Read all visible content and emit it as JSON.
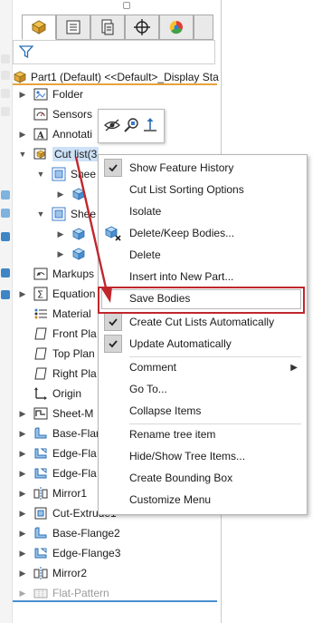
{
  "tabs": [
    {
      "icon": "feature-manager-icon",
      "active": true
    },
    {
      "icon": "property-manager-icon",
      "active": false
    },
    {
      "icon": "configuration-manager-icon",
      "active": false
    },
    {
      "icon": "dimxpert-manager-icon",
      "active": false
    },
    {
      "icon": "display-manager-icon",
      "active": false
    }
  ],
  "filter": {
    "icon": "filter-icon"
  },
  "tree": {
    "root_label": "Part1 (Default) <<Default>_Display Sta",
    "items": [
      {
        "label": "Folder"
      },
      {
        "label": "Sensors"
      },
      {
        "label": "Annotati"
      },
      {
        "label": "Cut list(3"
      },
      {
        "label": "Shee"
      },
      {
        "label": ""
      },
      {
        "label": "Shee"
      },
      {
        "label": ""
      },
      {
        "label": ""
      },
      {
        "label": "Markups"
      },
      {
        "label": "Equation"
      },
      {
        "label": "Material"
      },
      {
        "label": "Front Pla"
      },
      {
        "label": "Top Plan"
      },
      {
        "label": "Right Pla"
      },
      {
        "label": "Origin"
      },
      {
        "label": "Sheet-M"
      },
      {
        "label": "Base-Flan"
      },
      {
        "label": "Edge-Fla"
      },
      {
        "label": "Edge-Fla"
      },
      {
        "label": "Mirror1"
      },
      {
        "label": "Cut-Extrude1"
      },
      {
        "label": "Base-Flange2"
      },
      {
        "label": "Edge-Flange3"
      },
      {
        "label": "Mirror2"
      },
      {
        "label": "Flat-Pattern"
      }
    ]
  },
  "context_toolbar": [
    "hide-show-icon",
    "zoom-to-selection-icon",
    "normal-to-icon"
  ],
  "menu": {
    "items": [
      {
        "label": "Show Feature History",
        "checked": true
      },
      {
        "label": "Cut List Sorting Options"
      },
      {
        "label": "Isolate"
      },
      {
        "label": "Delete/Keep Bodies..."
      },
      {
        "label": "Delete"
      },
      {
        "label": "Insert into New Part..."
      },
      {
        "label": "Save Bodies"
      },
      {
        "label": "Create Cut Lists Automatically",
        "checked": true
      },
      {
        "label": "Update Automatically",
        "checked": true
      },
      {
        "label": "Comment",
        "submenu": true
      },
      {
        "label": "Go To..."
      },
      {
        "label": "Collapse Items"
      },
      {
        "label": "Rename tree item"
      },
      {
        "label": "Hide/Show Tree Items..."
      },
      {
        "label": "Create Bounding Box"
      },
      {
        "label": "Customize Menu"
      }
    ]
  },
  "colors": {
    "accent_orange": "#e8a33c",
    "highlight_red": "#c0272d",
    "selection_blue": "#cde1f7",
    "tree_rule_blue": "#4a8ed0"
  }
}
